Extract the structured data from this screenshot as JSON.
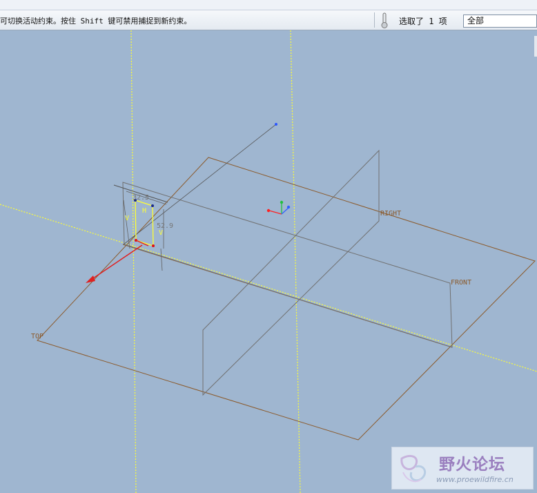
{
  "status": {
    "message": "可切换活动约束。按住 Shift 键可禁用捕捉到新约束。",
    "selected": "选取了 1 项",
    "filter_value": "全部"
  },
  "viewport": {
    "datums": {
      "top": "TOP",
      "right": "RIGHT",
      "front": "FRONT"
    },
    "dimensions": {
      "width": "32.5",
      "height": "52.9"
    },
    "constraint_v1": "V",
    "constraint_h": "H",
    "constraint_v2": "V"
  },
  "watermark": {
    "title": "野火论坛",
    "url": "www.proewildfire.cn"
  },
  "colors": {
    "background": "#9fb6d0",
    "datum_plane": "#8b5a2b",
    "sketch": "#ffff33",
    "axis_x": "#ff2020",
    "axis_y": "#20c040",
    "axis_z": "#3060ff"
  }
}
